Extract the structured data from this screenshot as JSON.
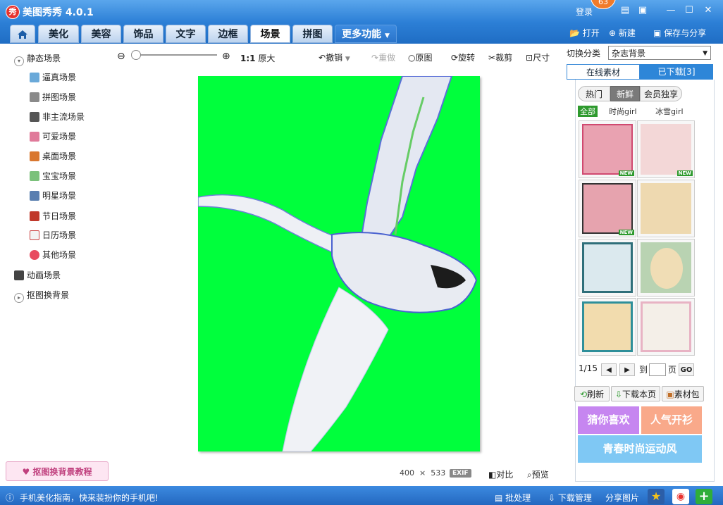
{
  "window": {
    "logo_text": "秀",
    "title": "美图秀秀 4.0.1",
    "login": "登录",
    "badge": "63"
  },
  "tabs": [
    {
      "label": "美化"
    },
    {
      "label": "美容"
    },
    {
      "label": "饰品"
    },
    {
      "label": "文字"
    },
    {
      "label": "边框"
    },
    {
      "label": "场景"
    },
    {
      "label": "拼图"
    },
    {
      "label": "更多功能"
    }
  ],
  "top_actions": {
    "open": "打开",
    "new": "新建",
    "save": "保存与分享"
  },
  "toolbar": {
    "ratio": "1:1",
    "original_size": "原大",
    "undo": "撤销",
    "redo": "重做",
    "original": "原图",
    "rotate": "旋转",
    "crop": "裁剪",
    "size": "尺寸"
  },
  "left_tree": {
    "static_label": "静态场景",
    "items": [
      "逼真场景",
      "拼图场景",
      "非主流场景",
      "可爱场景",
      "桌面场景",
      "宝宝场景",
      "明星场景",
      "节日场景",
      "日历场景",
      "其他场景"
    ],
    "animated_label": "动画场景",
    "cutout_label": "抠图换背景",
    "tutorial": "抠图换背景教程"
  },
  "canvas": {
    "width": "400",
    "times": "×",
    "height": "533",
    "exif": "EXIF",
    "compare": "对比",
    "preview": "预览"
  },
  "right_panel": {
    "category_label": "切换分类",
    "category_value": "杂志背景",
    "tab_online": "在线素材",
    "tab_downloaded": "已下载[3]",
    "pills": [
      "热门",
      "新鲜",
      "会员独享"
    ],
    "filters": [
      "全部",
      "时尚girl",
      "冰雪girl"
    ],
    "new_tag": "NEW",
    "page": "1/15",
    "goto": "到",
    "page_unit": "页",
    "go": "GO",
    "refresh": "刷新",
    "download_page": "下载本页",
    "package": "素材包",
    "banner1": "猜你喜欢",
    "banner2": "人气开衫",
    "banner3": "青春时尚运动风"
  },
  "statusbar": {
    "tip": "手机美化指南，快来装扮你的手机吧!",
    "batch": "批处理",
    "download_mgr": "下载管理",
    "share": "分享图片"
  }
}
